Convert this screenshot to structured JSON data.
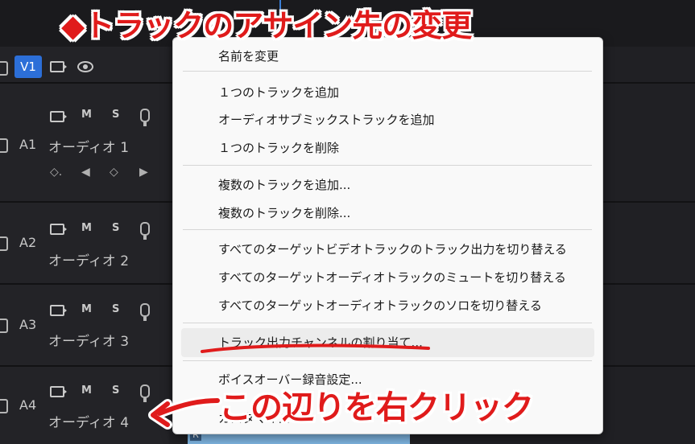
{
  "title_overlay": "◆トラックのアサイン先の変更",
  "annotation": "この辺りを右クリック",
  "annotation_color": "#e01b1b",
  "video_track": {
    "label": "V1"
  },
  "audio_tracks": [
    {
      "id": "A1",
      "name": "オーディオ 1",
      "m": "M",
      "s": "S"
    },
    {
      "id": "A2",
      "name": "オーディオ 2",
      "m": "M",
      "s": "S"
    },
    {
      "id": "A3",
      "name": "オーディオ 3",
      "m": "M",
      "s": "S"
    },
    {
      "id": "A4",
      "name": "オーディオ 4",
      "m": "M",
      "s": "S"
    }
  ],
  "clip": {
    "badge": "R",
    "color": "#7fb6e3"
  },
  "playhead_color": "#3b7fd6",
  "context_menu": {
    "items": [
      "名前を変更",
      "１つのトラックを追加",
      "オーディオサブミックストラックを追加",
      "１つのトラックを削除",
      "複数のトラックを追加...",
      "複数のトラックを削除...",
      "すべてのターゲットビデオトラックのトラック出力を切り替える",
      "すべてのターゲットオーディオトラックのミュートを切り替える",
      "すべてのターゲットオーディオトラックのソロを切り替える",
      "トラック出力チャンネルの割り当て...",
      "ボイスオーバー録音設定...",
      "カスタマイズ..."
    ]
  }
}
